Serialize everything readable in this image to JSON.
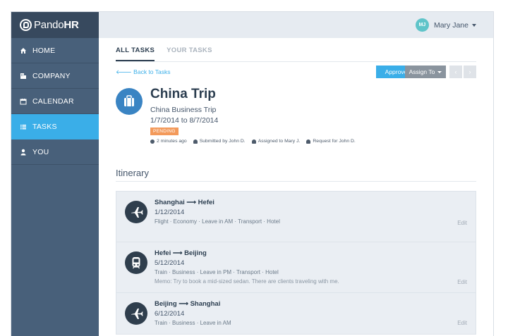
{
  "app": {
    "logo_prefix": "Pando",
    "logo_suffix": "HR"
  },
  "sidebar": {
    "items": [
      {
        "label": "HOME",
        "icon": "home-icon"
      },
      {
        "label": "COMPANY",
        "icon": "building-icon"
      },
      {
        "label": "CALENDAR",
        "icon": "calendar-icon"
      },
      {
        "label": "TASKS",
        "icon": "list-icon",
        "active": true
      },
      {
        "label": "YOU",
        "icon": "user-icon"
      }
    ]
  },
  "header": {
    "user_initials": "MJ",
    "user_name": "Mary Jane"
  },
  "tabs": [
    {
      "label": "ALL TASKS",
      "active": true
    },
    {
      "label": "YOUR TASKS"
    }
  ],
  "actions": {
    "back_label": "Back to Tasks",
    "approve_label": "Approve",
    "assign_label": "Assign To"
  },
  "task": {
    "title": "China Trip",
    "subtitle": "China Business Trip",
    "dates": "1/7/2014 to 8/7/2014",
    "status": "PENDING",
    "meta": {
      "time": "2 minutes ago",
      "submitted": "Submitted by John D.",
      "assigned": "Assigned to Mary J.",
      "request": "Request for John D."
    }
  },
  "itinerary": {
    "title": "Itinerary",
    "legs": [
      {
        "from": "Shanghai",
        "to": "Hefei",
        "date": "1/12/2014",
        "details": "Flight · Economy · Leave in AM · Transport · Hotel",
        "memo": "",
        "icon": "plane-icon",
        "edit": "Edit"
      },
      {
        "from": "Hefei",
        "to": "Beijing",
        "date": "5/12/2014",
        "details": "Train · Business · Leave in PM · Transport · Hotel",
        "memo": "Memo: Try to book a mid-sized sedan. There are clients traveling with me.",
        "icon": "train-icon",
        "edit": "Edit"
      },
      {
        "from": "Beijing",
        "to": "Shanghai",
        "date": "6/12/2014",
        "details": "Train · Business · Leave in AM",
        "memo": "",
        "icon": "plane-icon",
        "edit": "Edit"
      }
    ]
  },
  "colors": {
    "accent": "#3aaee8",
    "sidebar": "#48607a",
    "sidebar_dark": "#37495e",
    "pending": "#f39a5b",
    "avatar": "#5fc4c9"
  }
}
